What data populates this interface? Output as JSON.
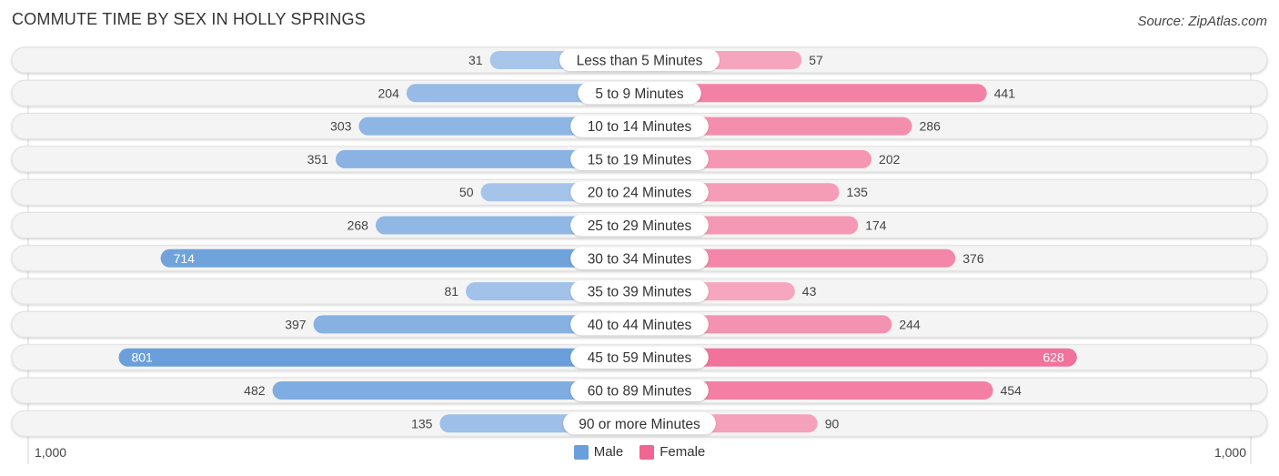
{
  "title": "COMMUTE TIME BY SEX IN HOLLY SPRINGS",
  "source": "Source: ZipAtlas.com",
  "axis": {
    "left_label": "1,000",
    "right_label": "1,000"
  },
  "legend": [
    {
      "label": "Male",
      "color": "#6a9fdb"
    },
    {
      "label": "Female",
      "color": "#f06592"
    }
  ],
  "chart_data": {
    "type": "bar",
    "orientation": "horizontal-diverging",
    "title": "COMMUTE TIME BY SEX IN HOLLY SPRINGS",
    "xlabel": "",
    "ylabel": "",
    "xlim": [
      -1000,
      1000
    ],
    "grid": false,
    "legend_position": "bottom-center",
    "categories": [
      "Less than 5 Minutes",
      "5 to 9 Minutes",
      "10 to 14 Minutes",
      "15 to 19 Minutes",
      "20 to 24 Minutes",
      "25 to 29 Minutes",
      "30 to 34 Minutes",
      "35 to 39 Minutes",
      "40 to 44 Minutes",
      "45 to 59 Minutes",
      "60 to 89 Minutes",
      "90 or more Minutes"
    ],
    "series": [
      {
        "name": "Male",
        "color": "#6a9fdb",
        "values": [
          31,
          204,
          303,
          351,
          50,
          268,
          714,
          81,
          397,
          801,
          482,
          135
        ]
      },
      {
        "name": "Female",
        "color": "#f06592",
        "values": [
          57,
          441,
          286,
          202,
          135,
          174,
          376,
          43,
          244,
          628,
          454,
          90
        ]
      }
    ]
  }
}
